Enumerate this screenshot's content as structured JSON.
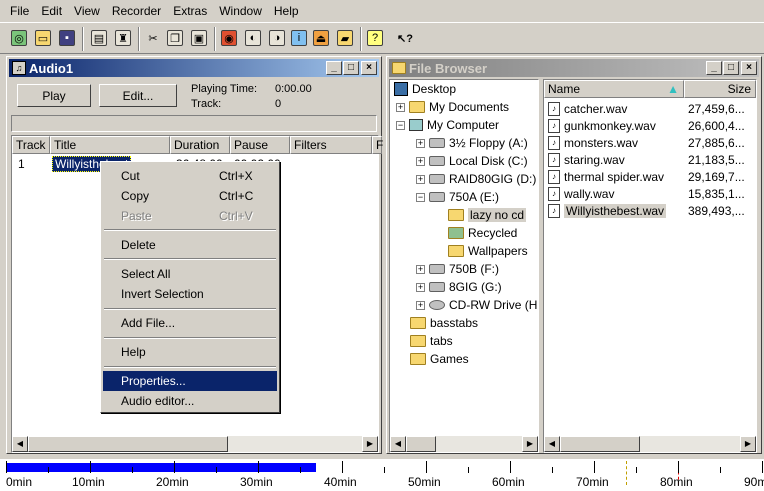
{
  "menubar": [
    "File",
    "Edit",
    "View",
    "Recorder",
    "Extras",
    "Window",
    "Help"
  ],
  "toolbar_icons": [
    "new-icon",
    "open-icon",
    "save-icon",
    "window-icon",
    "record-icon",
    "cut-icon",
    "copy-icon",
    "paste-icon",
    "burn-icon",
    "disc-icon",
    "disc2-icon",
    "info-icon",
    "eject-icon",
    "folder-icon",
    "help-icon",
    "whats-this-icon"
  ],
  "audio": {
    "title": "Audio1",
    "play_label": "Play",
    "edit_label": "Edit...",
    "playing_time_label": "Playing Time:",
    "playing_time": "0:00.00",
    "track_label": "Track:",
    "track_value": "0",
    "columns": [
      "Track",
      "Title",
      "Duration",
      "Pause",
      "Filters",
      "F"
    ],
    "row": {
      "track": "1",
      "title": "Willyisthebest",
      "duration": "36:48.00",
      "pause": "00:02.00"
    }
  },
  "context_menu": {
    "cut": {
      "label": "Cut",
      "shortcut": "Ctrl+X"
    },
    "copy": {
      "label": "Copy",
      "shortcut": "Ctrl+C"
    },
    "paste": {
      "label": "Paste",
      "shortcut": "Ctrl+V"
    },
    "delete": "Delete",
    "select_all": "Select All",
    "invert_selection": "Invert Selection",
    "add_file": "Add File...",
    "help": "Help",
    "properties": "Properties...",
    "audio_editor": "Audio editor..."
  },
  "browser": {
    "title": "File Browser",
    "tree": [
      "Desktop",
      "My Documents",
      "My Computer",
      "3½ Floppy (A:)",
      "Local Disk (C:)",
      "RAID80GIG (D:)",
      "750A (E:)",
      "lazy no cd",
      "Recycled",
      "Wallpapers",
      "750B (F:)",
      "8GIG (G:)",
      "CD-RW Drive (H",
      "basstabs",
      "tabs",
      "Games"
    ],
    "col_name": "Name",
    "col_size": "Size",
    "files": [
      {
        "name": "catcher.wav",
        "size": "27,459,6..."
      },
      {
        "name": "gunkmonkey.wav",
        "size": "26,600,4..."
      },
      {
        "name": "monsters.wav",
        "size": "27,885,6..."
      },
      {
        "name": "staring.wav",
        "size": "21,183,5..."
      },
      {
        "name": "thermal spider.wav",
        "size": "29,169,7..."
      },
      {
        "name": "wally.wav",
        "size": "15,835,1..."
      },
      {
        "name": "Willyisthebest.wav",
        "size": "389,493,..."
      }
    ]
  },
  "ruler": {
    "labels": [
      "0min",
      "10min",
      "20min",
      "30min",
      "40min",
      "50min",
      "60min",
      "70min",
      "80min",
      "90min"
    ],
    "used_fraction": 0.41
  }
}
